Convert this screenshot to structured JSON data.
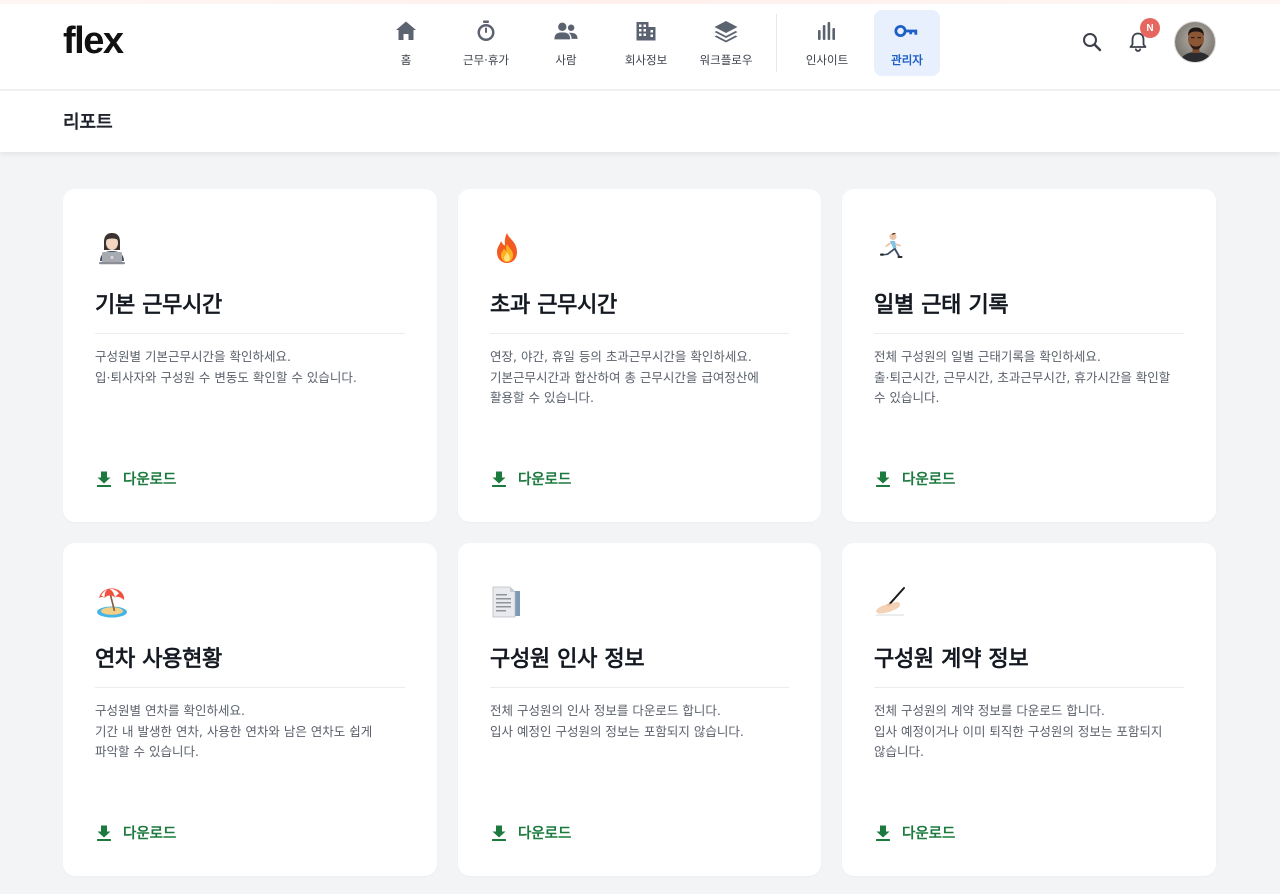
{
  "app": {
    "logo": "flex"
  },
  "nav": {
    "items": [
      {
        "label": "홈",
        "icon": "home-icon"
      },
      {
        "label": "근무·휴가",
        "icon": "stopwatch-icon"
      },
      {
        "label": "사람",
        "icon": "people-icon"
      },
      {
        "label": "회사정보",
        "icon": "building-icon"
      },
      {
        "label": "워크플로우",
        "icon": "layers-icon"
      },
      {
        "label": "인사이트",
        "icon": "bar-chart-icon"
      },
      {
        "label": "관리자",
        "icon": "key-icon",
        "active": true
      }
    ]
  },
  "utility": {
    "notification_badge": "N"
  },
  "page": {
    "title": "리포트"
  },
  "reports": [
    {
      "emoji": "technologist-emoji",
      "title": "기본 근무시간",
      "desc": [
        "구성원별 기본근무시간을 확인하세요.",
        "입·퇴사자와 구성원 수 변동도 확인할 수 있습니다."
      ],
      "download": "다운로드"
    },
    {
      "emoji": "fire-emoji",
      "title": "초과 근무시간",
      "desc": [
        "연장, 야간, 휴일 등의 초과근무시간을 확인하세요.",
        "기본근무시간과 합산하여 총 근무시간을 급여정산에",
        "활용할 수 있습니다."
      ],
      "download": "다운로드"
    },
    {
      "emoji": "runner-emoji",
      "title": "일별 근태 기록",
      "desc": [
        "전체 구성원의 일별 근태기록을 확인하세요.",
        "출·퇴근시간, 근무시간, 초과근무시간, 휴가시간을 확인할",
        "수 있습니다."
      ],
      "download": "다운로드"
    },
    {
      "emoji": "beach-umbrella-emoji",
      "title": "연차 사용현황",
      "desc": [
        "구성원별 연차를 확인하세요.",
        "기간 내 발생한 연차, 사용한 연차와 남은 연차도 쉽게",
        "파악할 수 있습니다."
      ],
      "download": "다운로드"
    },
    {
      "emoji": "document-emoji",
      "title": "구성원 인사 정보",
      "desc": [
        "전체 구성원의 인사 정보를 다운로드 합니다.",
        "입사 예정인 구성원의 정보는 포함되지 않습니다."
      ],
      "download": "다운로드"
    },
    {
      "emoji": "writing-hand-emoji",
      "title": "구성원 계약 정보",
      "desc": [
        "전체 구성원의 계약 정보를 다운로드 합니다.",
        "입사 예정이거나 이미 퇴직한 구성원의 정보는 포함되지",
        "않습니다."
      ],
      "download": "다운로드"
    }
  ],
  "colors": {
    "accent": "#1f5fc6",
    "active_bg": "#e8f0fd",
    "download": "#1c7a3e",
    "badge": "#e5675f",
    "background": "#f3f4f6"
  }
}
